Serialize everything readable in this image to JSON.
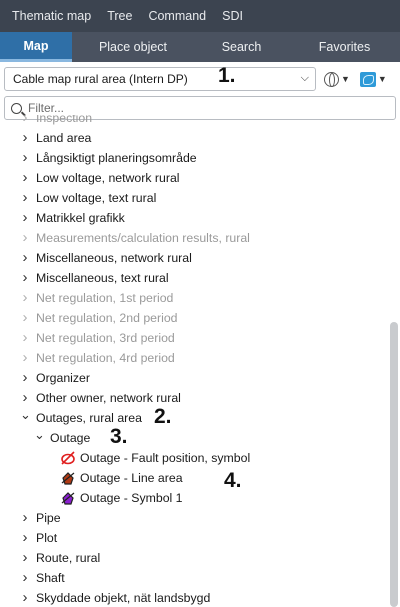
{
  "menubar": {
    "items": [
      "Thematic map",
      "Tree",
      "Command",
      "SDI"
    ]
  },
  "tabs": [
    "Map",
    "Place object",
    "Search",
    "Favorites"
  ],
  "map_select": {
    "value": "Cable map rural area (Intern DP)"
  },
  "filter": {
    "placeholder": "Filter..."
  },
  "tree": {
    "rows": [
      {
        "label": "Inspection",
        "level": 0,
        "dim": true,
        "expanded": false
      },
      {
        "label": "Land area",
        "level": 0,
        "dim": false,
        "expanded": false
      },
      {
        "label": "Långsiktigt planeringsområde",
        "level": 0,
        "dim": false,
        "expanded": false
      },
      {
        "label": "Low voltage, network rural",
        "level": 0,
        "dim": false,
        "expanded": false
      },
      {
        "label": "Low voltage, text rural",
        "level": 0,
        "dim": false,
        "expanded": false
      },
      {
        "label": "Matrikkel grafikk",
        "level": 0,
        "dim": false,
        "expanded": false
      },
      {
        "label": "Measurements/calculation results, rural",
        "level": 0,
        "dim": true,
        "expanded": false
      },
      {
        "label": "Miscellaneous, network rural",
        "level": 0,
        "dim": false,
        "expanded": false
      },
      {
        "label": "Miscellaneous, text rural",
        "level": 0,
        "dim": false,
        "expanded": false
      },
      {
        "label": "Net regulation, 1st period",
        "level": 0,
        "dim": true,
        "expanded": false
      },
      {
        "label": "Net regulation, 2nd period",
        "level": 0,
        "dim": true,
        "expanded": false
      },
      {
        "label": "Net regulation, 3rd period",
        "level": 0,
        "dim": true,
        "expanded": false
      },
      {
        "label": "Net regulation, 4rd period",
        "level": 0,
        "dim": true,
        "expanded": false
      },
      {
        "label": "Organizer",
        "level": 0,
        "dim": false,
        "expanded": false
      },
      {
        "label": "Other owner, network rural",
        "level": 0,
        "dim": false,
        "expanded": false
      },
      {
        "label": "Outages, rural area",
        "level": 0,
        "dim": false,
        "expanded": true
      },
      {
        "label": "Outage",
        "level": 1,
        "dim": false,
        "expanded": true
      },
      {
        "label": "Outage - Fault position, symbol",
        "level": 2,
        "dim": false,
        "icon": "fault-position-symbol-icon"
      },
      {
        "label": "Outage - Line area",
        "level": 2,
        "dim": false,
        "icon": "line-area-symbol-icon"
      },
      {
        "label": "Outage - Symbol 1",
        "level": 2,
        "dim": false,
        "icon": "purple-symbol-icon"
      },
      {
        "label": "Pipe",
        "level": 0,
        "dim": false,
        "expanded": false
      },
      {
        "label": "Plot",
        "level": 0,
        "dim": false,
        "expanded": false
      },
      {
        "label": "Route, rural",
        "level": 0,
        "dim": false,
        "expanded": false
      },
      {
        "label": "Shaft",
        "level": 0,
        "dim": false,
        "expanded": false
      },
      {
        "label": "Skyddade objekt, nät landsbygd",
        "level": 0,
        "dim": false,
        "expanded": false
      }
    ]
  },
  "annotations": [
    "1.",
    "2.",
    "3.",
    "4."
  ],
  "colors": {
    "menubar": "#3c4450",
    "tabbar": "#4a5260",
    "active_tab": "#2f6fa7"
  }
}
